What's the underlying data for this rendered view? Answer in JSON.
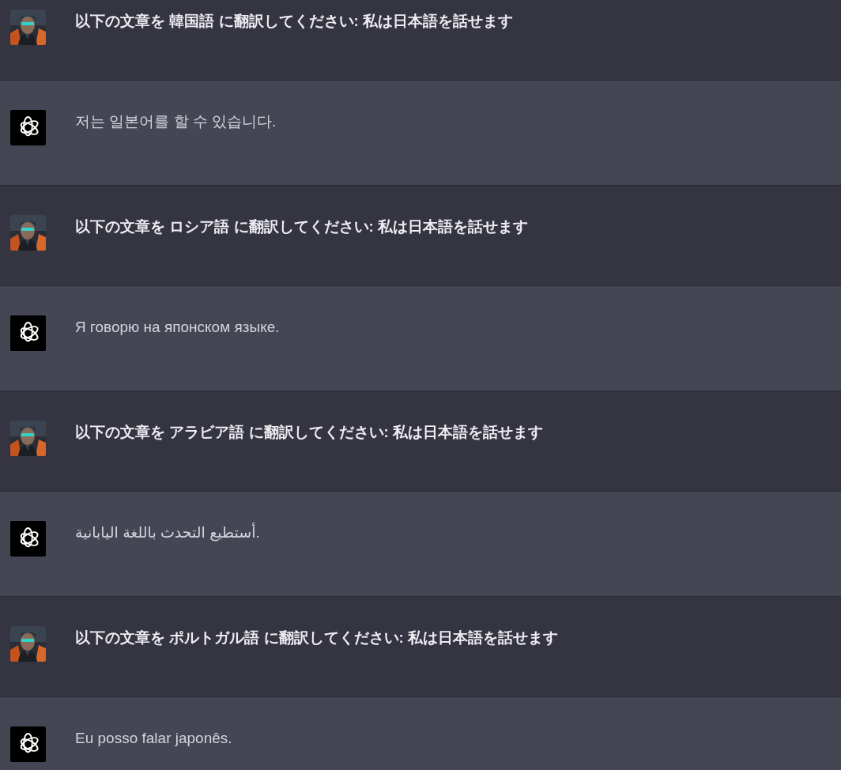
{
  "messages": [
    {
      "kind": "user",
      "text": "以下の文章を 韓国語 に翻訳してください: 私は日本語を話せます"
    },
    {
      "kind": "assistant",
      "text": "저는 일본어를 할 수 있습니다."
    },
    {
      "kind": "user",
      "text": "以下の文章を ロシア語 に翻訳してください: 私は日本語を話せます"
    },
    {
      "kind": "assistant",
      "text": "Я говорю на японском языке."
    },
    {
      "kind": "user",
      "text": "以下の文章を アラビア語 に翻訳してください: 私は日本語を話せます"
    },
    {
      "kind": "assistant",
      "text": "أستطيع التحدث باللغة اليابانية."
    },
    {
      "kind": "user",
      "text": "以下の文章を ポルトガル語 に翻訳してください: 私は日本語を話せます"
    },
    {
      "kind": "assistant",
      "text": "Eu posso falar japonês."
    }
  ]
}
